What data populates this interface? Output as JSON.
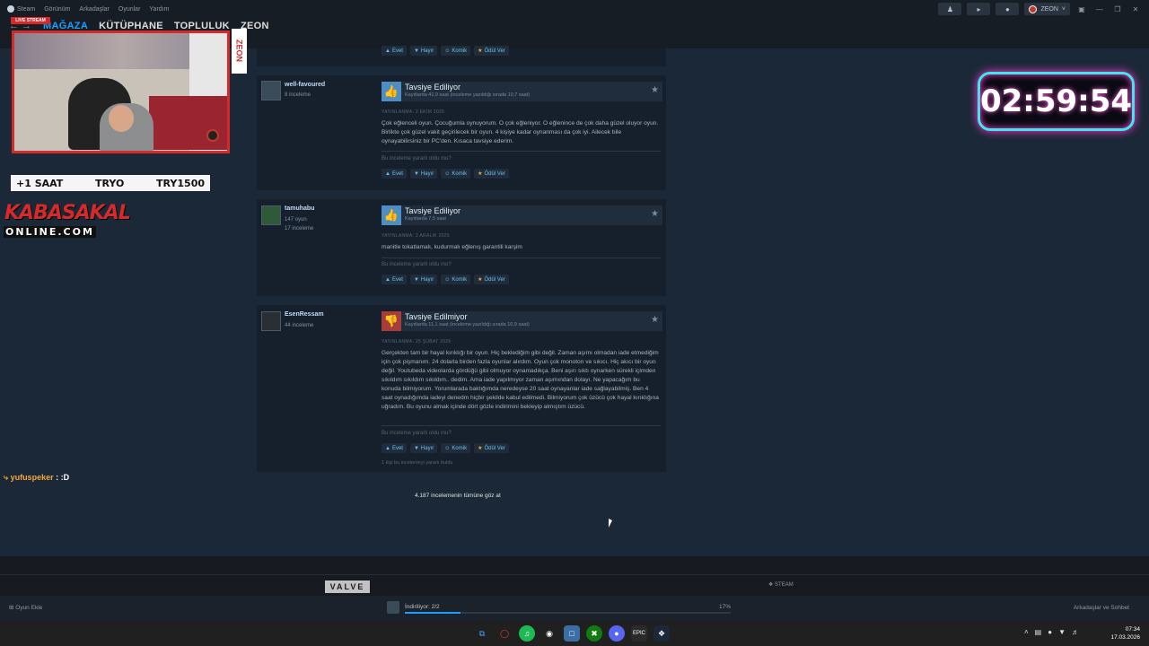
{
  "titlebar": {
    "menu": [
      "Steam",
      "Görünüm",
      "Arkadaşlar",
      "Oyunlar",
      "Yardım"
    ],
    "username": "ZEON"
  },
  "nav": {
    "links": [
      "MAĞAZA",
      "KÜTÜPHANE",
      "TOPLULUK",
      "ZEON"
    ],
    "active_index": 0
  },
  "vote_labels": {
    "yes": "Evet",
    "no": "Hayır",
    "funny": "Komik",
    "award": "Ödül Ver"
  },
  "helpful_question": "Bu inceleme yararlı oldu mu?",
  "reviews": [
    {
      "author": "well-favoured",
      "author_meta": [
        "8 inceleme"
      ],
      "recommend": true,
      "title": "Tavsiye Ediliyor",
      "hours": "Kayıtlarda 41,9 saat (inceleme yazıldığı sırada 10,7 saat)",
      "posted": "YAYINLANMA: 2 EKİM 2025",
      "text": "Çok eğlenceli oyun. Çocuğumla oynuyorum. O çok eğleniyor. O eğlenince de çok daha güzel oluyor oyun. Birlikte çok güzel vakit geçirilecek bir oyun. 4 kişiye kadar oynanması da çok iyi. Ailecek bile oynayabilirsiniz bir PC'den. Kısaca tavsiye ederim."
    },
    {
      "author": "tamuhabu",
      "author_meta": [
        "147 oyun",
        "17 inceleme"
      ],
      "recommend": true,
      "title": "Tavsiye Ediliyor",
      "hours": "Kayıtlarda 7,5 saat",
      "posted": "YAYINLANMA: 3 ARALIK 2025",
      "text": "manitle tokatlamalı, kudurmalı eğlenış garantili karşim"
    },
    {
      "author": "EsenRessam",
      "author_meta": [
        "44 inceleme"
      ],
      "recommend": false,
      "title": "Tavsiye Edilmiyor",
      "hours": "Kayıtlarda 11,1 saat (inceleme yazıldığı sırada 10,9 saat)",
      "posted": "YAYINLANMA: 25 ŞUBAT 2026",
      "text": "Gerçekten tam bir hayal kırıklığı bir oyun. Hiç beklediğim gibi değil. Zaman aşımı olmadan iade etmediğim için çok pişmanım. 24 dolarla birden fazla oyunlar alırdım. Oyun çok monoton ve sıkıcı. Hiç akıcı bir oyun değil. Youtubeda videolarda gördüğü gibi olmuyor oynamadıkça. Beni aşırı sıktı oynarken sürekli içimden sıkıldım sıkıldım sıkıldım.. dedim. Ama iade yapılmıyor zaman aşımından dolayı. Ne yapacağım bu konuda bilmiyorum. Yorumlarada baktığımda neredeyse 20 saat oynayanlar iade sağlayabilmiş. Ben 4 saat oynadığımda iadeyi denedm hiçbir şekilde kabul edilmedi. Bilmiyorum çok üzücü çok hayal kırıklığına uğradım. Bu oyunu almak içinde dört gözle indirimini bekleyip almıştım üzücü.",
      "found_helpful": "1 kişi bu incelemeyi yararlı buldu"
    }
  ],
  "see_all": "4.187 incelemenin tümüne göz at",
  "footer": {
    "valve": "VALVE",
    "steam": "STEAM"
  },
  "statusbar": {
    "add_game": "Oyun Ekle",
    "download_text": "İndiriliyor: 2/2",
    "download_progress": 0.17,
    "download_percent": "17%",
    "friends": "Arkadaşlar ve Sohbet"
  },
  "clock": {
    "time": "07:34",
    "date": "17.03.2026"
  },
  "overlay": {
    "live_badge": "LIVE STREAM",
    "zeon_tag": "ZEON",
    "promo": [
      "+1 SAAT",
      "TRYO",
      "TRY1500"
    ],
    "brand_line1": "KABASAKAL",
    "brand_line2": "ONLINE.COM",
    "chat_user": "yufuspeker",
    "chat_msg": ": :D",
    "timer": "02:59:54"
  }
}
